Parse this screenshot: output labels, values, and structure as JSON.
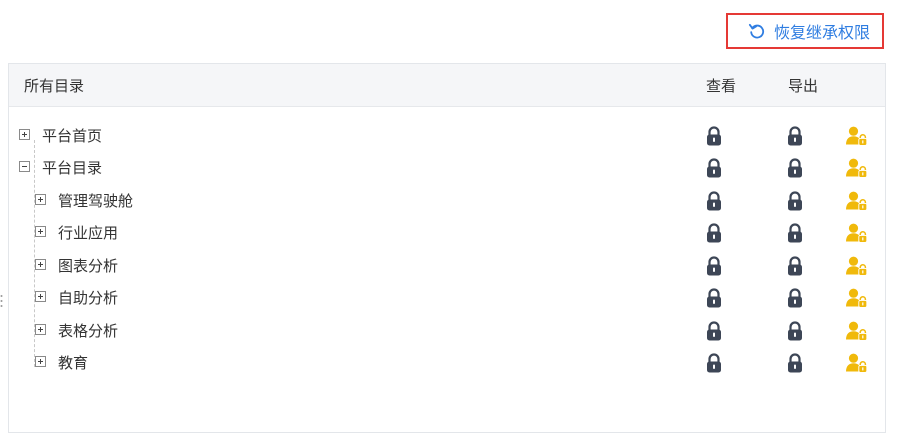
{
  "toolbar": {
    "restore_label": "恢复继承权限",
    "restore_icon": "refresh-icon",
    "accent_color": "#2f7de1"
  },
  "table": {
    "header": {
      "directory": "所有目录",
      "view": "查看",
      "export": "导出"
    },
    "rows": [
      {
        "label": "平台首页",
        "level": 0,
        "expanded": false
      },
      {
        "label": "平台目录",
        "level": 0,
        "expanded": true
      },
      {
        "label": "管理驾驶舱",
        "level": 1,
        "expanded": false
      },
      {
        "label": "行业应用",
        "level": 1,
        "expanded": false
      },
      {
        "label": "图表分析",
        "level": 1,
        "expanded": false
      },
      {
        "label": "自助分析",
        "level": 1,
        "expanded": false
      },
      {
        "label": "表格分析",
        "level": 1,
        "expanded": false
      },
      {
        "label": "教育",
        "level": 1,
        "expanded": false
      }
    ]
  },
  "icons": {
    "view": "lock-icon",
    "export": "lock-icon",
    "inherit": "user-lock-icon"
  },
  "colors": {
    "lock": "#3d4656",
    "user": "#f0b90b",
    "highlight_border": "#e53935"
  }
}
